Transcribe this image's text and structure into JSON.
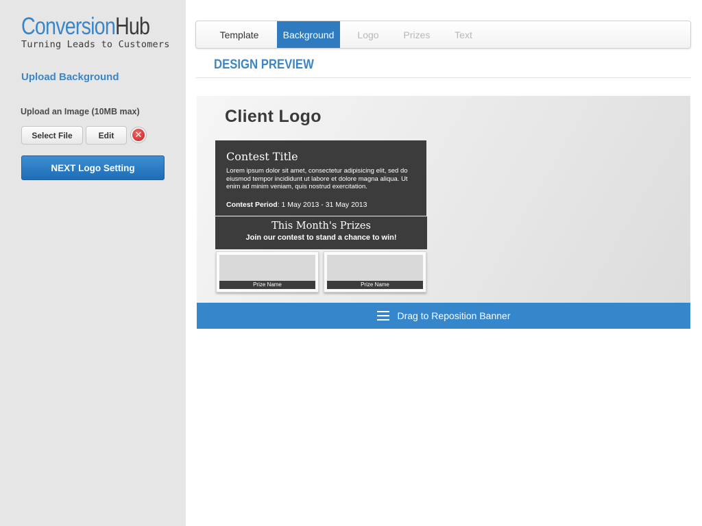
{
  "brand": {
    "name_part1": "Conversion",
    "name_part2": "Hub",
    "tagline": "Turning Leads to Customers",
    "accent_color": "#3b86c8"
  },
  "sidebar": {
    "section_title": "Upload Background",
    "upload_label": "Upload an Image (10MB max)",
    "select_file_label": "Select File",
    "edit_label": "Edit",
    "remove_icon": "close-icon",
    "next_button_label": "NEXT Logo Setting"
  },
  "tabs": [
    {
      "label": "Template",
      "state": "normal"
    },
    {
      "label": "Background",
      "state": "active"
    },
    {
      "label": "Logo",
      "state": "disabled"
    },
    {
      "label": "Prizes",
      "state": "disabled"
    },
    {
      "label": "Text",
      "state": "disabled"
    }
  ],
  "preview": {
    "title": "DESIGN PREVIEW",
    "client_logo": "Client Logo",
    "contest": {
      "title": "Contest Title",
      "body": "Lorem ipsum dolor sit amet, consectetur adipisicing elit, sed do eiusmod tempor incididunt ut labore et dolore magna aliqua. Ut enim ad minim veniam, quis nostrud exercitation.",
      "period_label": "Contest Period",
      "period_value": ": 1 May 2013 - 31 May 2013"
    },
    "prizes": {
      "title": "This Month's Prizes",
      "subtitle": "Join our contest to stand a chance to win!",
      "items": [
        {
          "name": "Prize Name"
        },
        {
          "name": "Prize Name"
        }
      ]
    },
    "drag_label": "Drag to Reposition Banner",
    "drag_icon": "menu-icon"
  }
}
